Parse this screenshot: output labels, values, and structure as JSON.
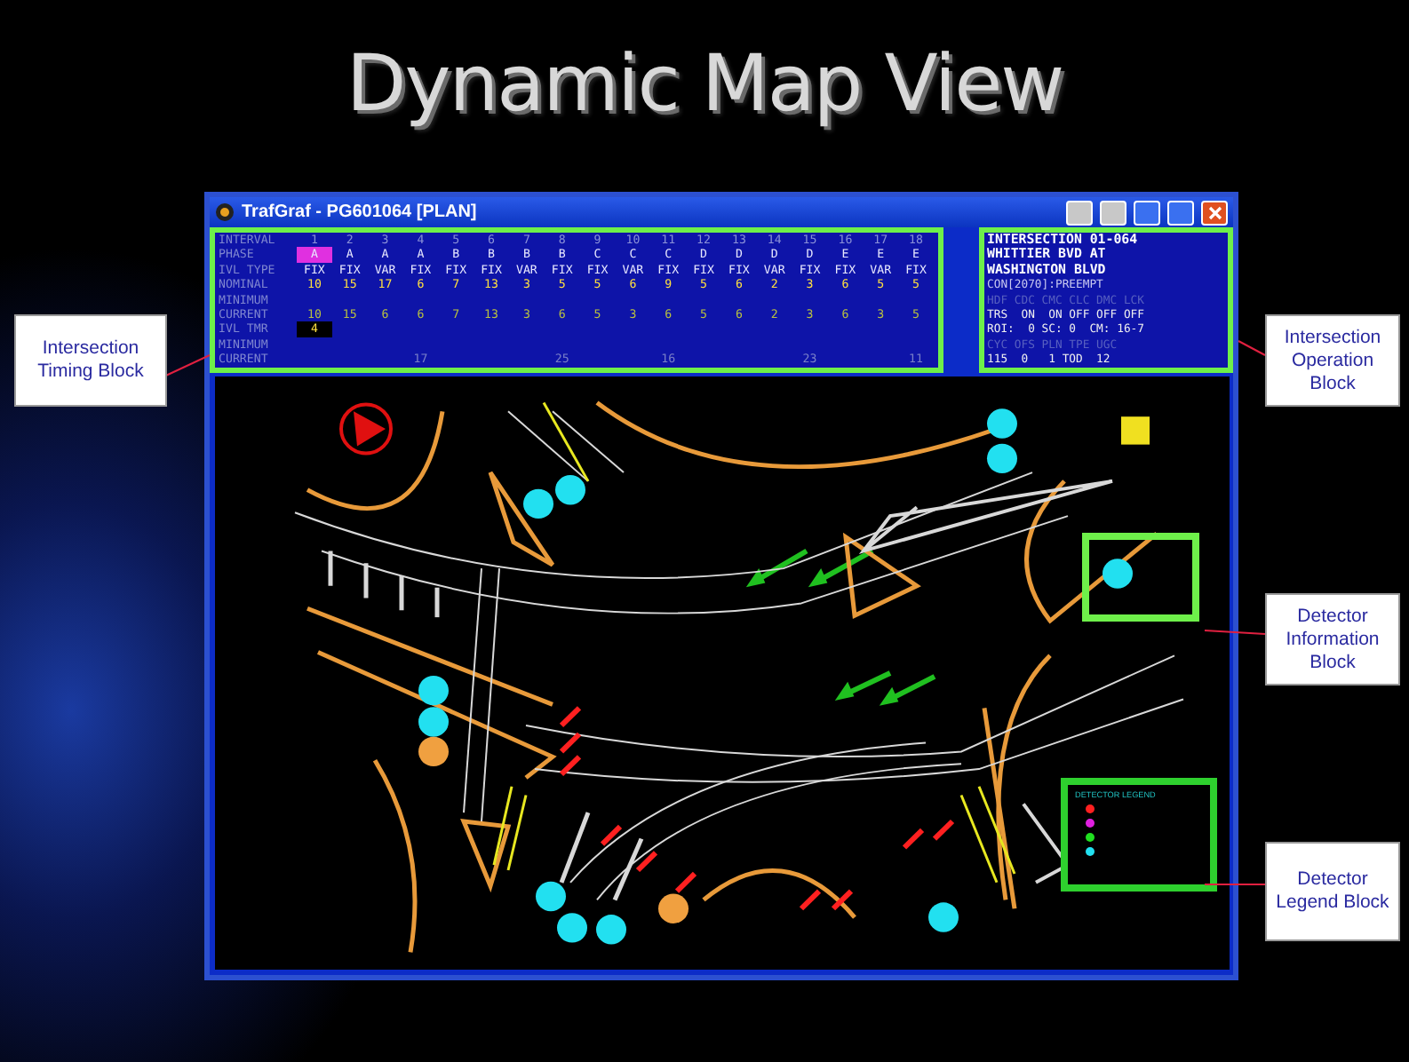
{
  "slide": {
    "title": "Dynamic Map View"
  },
  "window": {
    "title": "TrafGraf - PG601064 [PLAN]"
  },
  "timing": {
    "rows": [
      {
        "label": "INTERVAL",
        "kind": "number"
      },
      {
        "label": "PHASE",
        "kind": "phase"
      },
      {
        "label": "IVL TYPE",
        "kind": "type"
      },
      {
        "label": "NOMINAL",
        "kind": "nominal"
      },
      {
        "label": "MINIMUM",
        "kind": "minimum"
      },
      {
        "label": "CURRENT",
        "kind": "current"
      },
      {
        "label": "IVL TMR",
        "kind": "timer"
      },
      {
        "label": "MINIMUM",
        "kind": "minimum"
      },
      {
        "label": "CURRENT",
        "kind": "cycle"
      }
    ],
    "intervals": [
      {
        "number": "1",
        "phase": "A",
        "type": "FIX",
        "nominal": "10",
        "current": "10",
        "timer": "4",
        "selected": true
      },
      {
        "number": "2",
        "phase": "A",
        "type": "FIX",
        "nominal": "15",
        "current": "15",
        "selected": false
      },
      {
        "number": "3",
        "phase": "A",
        "type": "VAR",
        "nominal": "17",
        "current": "6",
        "selected": false
      },
      {
        "number": "4",
        "phase": "A",
        "type": "FIX",
        "nominal": "6",
        "current": "6",
        "cycle": "17",
        "selected": false
      },
      {
        "number": "5",
        "phase": "B",
        "type": "FIX",
        "nominal": "7",
        "current": "7",
        "selected": false
      },
      {
        "number": "6",
        "phase": "B",
        "type": "FIX",
        "nominal": "13",
        "current": "13",
        "selected": false
      },
      {
        "number": "7",
        "phase": "B",
        "type": "VAR",
        "nominal": "3",
        "current": "3",
        "selected": false
      },
      {
        "number": "8",
        "phase": "B",
        "type": "FIX",
        "nominal": "5",
        "current": "6",
        "cycle": "25",
        "selected": false
      },
      {
        "number": "9",
        "phase": "C",
        "type": "FIX",
        "nominal": "5",
        "current": "5",
        "selected": false
      },
      {
        "number": "10",
        "phase": "C",
        "type": "VAR",
        "nominal": "6",
        "current": "3",
        "selected": false
      },
      {
        "number": "11",
        "phase": "C",
        "type": "FIX",
        "nominal": "9",
        "current": "6",
        "cycle": "16",
        "selected": false
      },
      {
        "number": "12",
        "phase": "D",
        "type": "FIX",
        "nominal": "5",
        "current": "5",
        "selected": false
      },
      {
        "number": "13",
        "phase": "D",
        "type": "FIX",
        "nominal": "6",
        "current": "6",
        "selected": false
      },
      {
        "number": "14",
        "phase": "D",
        "type": "VAR",
        "nominal": "2",
        "current": "2",
        "selected": false
      },
      {
        "number": "15",
        "phase": "D",
        "type": "FIX",
        "nominal": "3",
        "current": "3",
        "cycle": "23",
        "selected": false
      },
      {
        "number": "16",
        "phase": "E",
        "type": "FIX",
        "nominal": "6",
        "current": "6",
        "selected": false
      },
      {
        "number": "17",
        "phase": "E",
        "type": "VAR",
        "nominal": "5",
        "current": "3",
        "selected": false
      },
      {
        "number": "18",
        "phase": "E",
        "type": "FIX",
        "nominal": "5",
        "current": "5",
        "cycle": "11",
        "selected": false
      }
    ]
  },
  "operation": {
    "lines": [
      {
        "text": "INTERSECTION 01-064",
        "kind": "title"
      },
      {
        "text": "WHITTIER BVD AT",
        "kind": "title"
      },
      {
        "text": "WASHINGTON BLVD",
        "kind": "title"
      },
      {
        "text": "CON[2070]:PREEMPT",
        "kind": "plain"
      },
      {
        "text": "HDF CDC CMC CLC DMC LCK",
        "kind": "header"
      },
      {
        "text": "TRS  ON  ON OFF OFF OFF",
        "kind": "value"
      },
      {
        "text": "ROI:  0 SC: 0  CM: 16-7",
        "kind": "value"
      },
      {
        "text": "CYC OFS PLN TPE UGC",
        "kind": "header"
      },
      {
        "text": "115  0   1 TOD  12",
        "kind": "value"
      }
    ]
  },
  "map": {
    "detectors": [
      {
        "color": "#22e0f0"
      },
      {
        "color": "#22e0f0"
      },
      {
        "color": "#22e0f0"
      },
      {
        "color": "#22e0f0"
      },
      {
        "color": "#22e0f0"
      },
      {
        "color": "#22e0f0"
      },
      {
        "color": "#22e0f0"
      },
      {
        "color": "#f0a040"
      },
      {
        "color": "#22e0f0"
      },
      {
        "color": "#22e0f0"
      },
      {
        "color": "#22e0f0"
      },
      {
        "color": "#f0a040"
      },
      {
        "color": "#22e0f0"
      }
    ],
    "legend": {
      "title": "DETECTOR LEGEND",
      "items": [
        {
          "color": "#ff2020"
        },
        {
          "color": "#e020e0"
        },
        {
          "color": "#20e020"
        },
        {
          "color": "#22e0f0"
        }
      ]
    }
  },
  "callouts": [
    {
      "text": "Intersection Timing Block",
      "kind": "timing"
    },
    {
      "text": "Intersection Operation Block",
      "kind": "operation"
    },
    {
      "text": "Detector Information Block",
      "kind": "detector"
    },
    {
      "text": "Detector Legend Block",
      "kind": "legend"
    }
  ]
}
